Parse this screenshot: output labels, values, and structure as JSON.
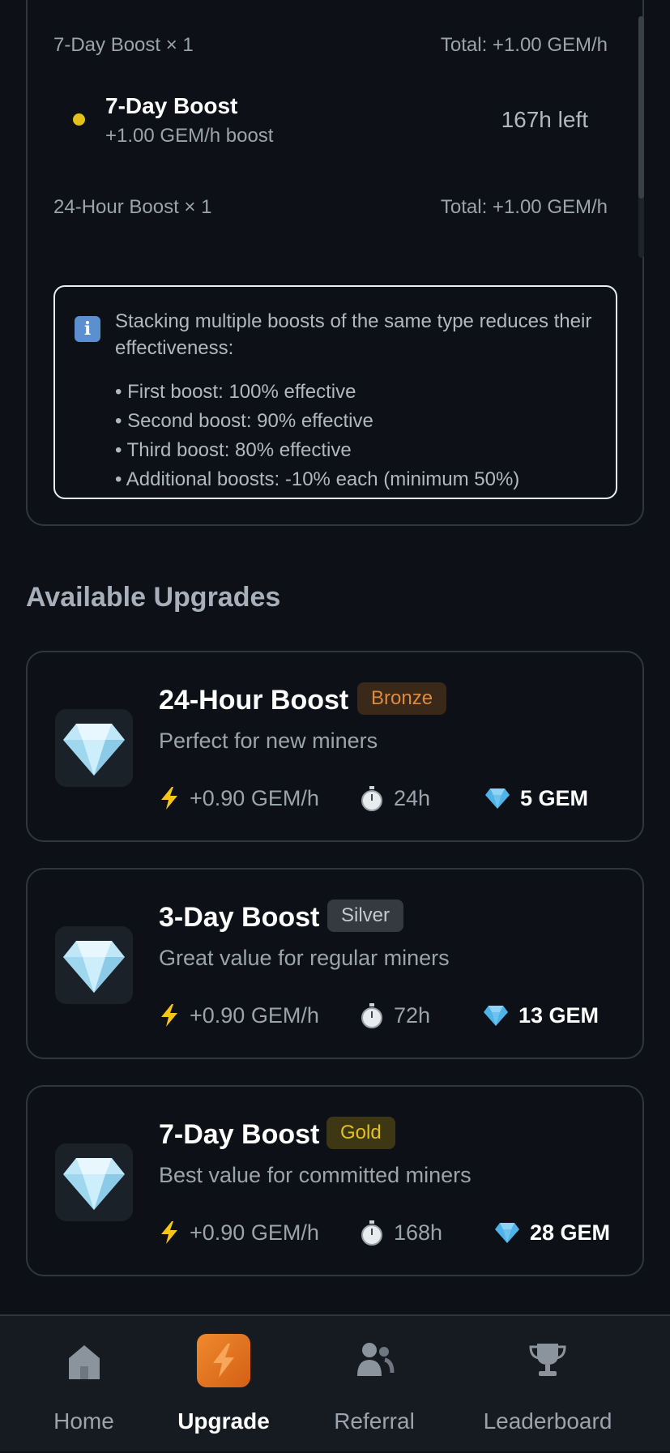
{
  "active_boosts": {
    "groups": [
      {
        "label": "7-Day Boost × 1",
        "total": "Total: +1.00 GEM/h"
      },
      {
        "label": "24-Hour Boost × 1",
        "total": "Total: +1.00 GEM/h"
      }
    ],
    "boost_item": {
      "name": "7-Day Boost",
      "rate": "+1.00 GEM/h boost",
      "time_left": "167h left",
      "dot_color": "#e3c11a"
    }
  },
  "stacking_info": {
    "icon": "info-icon",
    "text": "Stacking multiple boosts of the same type reduces their effectiveness:",
    "items": [
      "• First boost: 100% effective",
      "• Second boost: 90% effective",
      "• Third boost: 80% effective",
      "• Additional boosts: -10% each (minimum 50%)"
    ]
  },
  "upgrades": {
    "title": "Available Upgrades",
    "cards": [
      {
        "name": "24-Hour Boost",
        "tier": "Bronze",
        "tier_bg": "#3a2818",
        "tier_fg": "#e08a3c",
        "description": "Perfect for new miners",
        "rate": "+0.90 GEM/h",
        "duration": "24h",
        "cost": "5 GEM"
      },
      {
        "name": "3-Day Boost",
        "tier": "Silver",
        "tier_bg": "#353a40",
        "tier_fg": "#c4cad1",
        "description": "Great value for regular miners",
        "rate": "+0.90 GEM/h",
        "duration": "72h",
        "cost": "13 GEM"
      },
      {
        "name": "7-Day Boost",
        "tier": "Gold",
        "tier_bg": "#3d3714",
        "tier_fg": "#e3c11a",
        "description": "Best value for committed miners",
        "rate": "+0.90 GEM/h",
        "duration": "168h",
        "cost": "28 GEM"
      }
    ]
  },
  "nav": {
    "items": [
      {
        "label": "Home",
        "icon": "home-icon"
      },
      {
        "label": "Upgrade",
        "icon": "lightning-icon",
        "active": true
      },
      {
        "label": "Referral",
        "icon": "users-icon"
      },
      {
        "label": "Leaderboard",
        "icon": "trophy-icon"
      }
    ]
  },
  "colors": {
    "accent": "#e67e22",
    "background": "#0d1117",
    "card_border": "#30363d"
  }
}
